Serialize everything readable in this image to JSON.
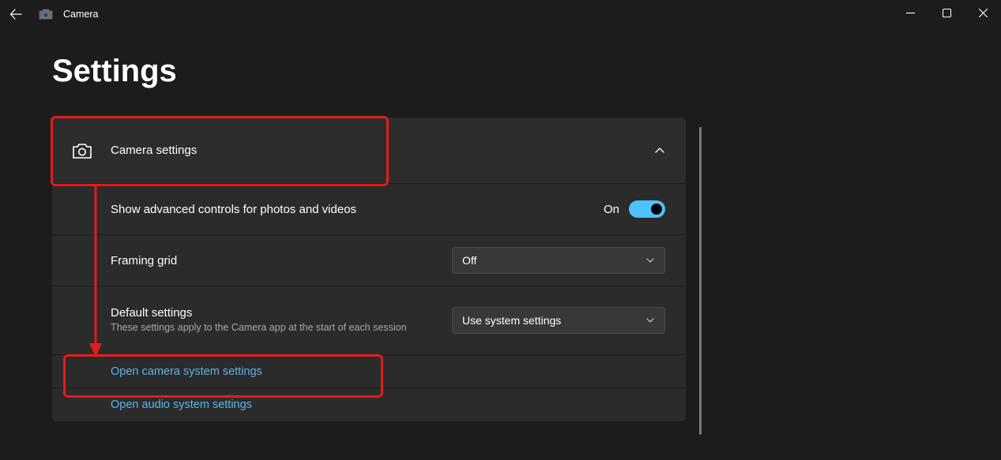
{
  "titlebar": {
    "app_name": "Camera"
  },
  "page": {
    "title": "Settings"
  },
  "panel": {
    "header": "Camera settings",
    "advanced": {
      "label": "Show advanced controls for photos and videos",
      "state_label": "On"
    },
    "framing": {
      "label": "Framing grid",
      "value": "Off"
    },
    "defaults": {
      "label": "Default settings",
      "sub": "These settings apply to the Camera app at the start of each session",
      "value": "Use system settings"
    },
    "link_camera": "Open camera system settings",
    "link_audio": "Open audio system settings"
  }
}
